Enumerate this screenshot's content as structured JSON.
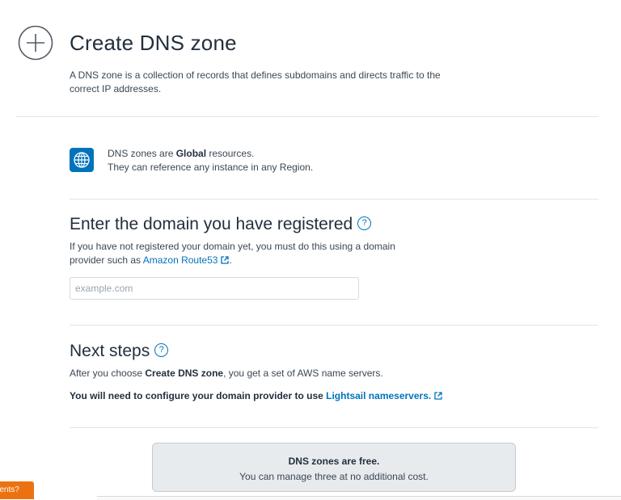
{
  "header": {
    "title": "Create DNS zone",
    "description": "A DNS zone is a collection of records that defines subdomains and directs traffic to the correct IP addresses.",
    "icon": "plus-circle-icon"
  },
  "info": {
    "icon": "globe-icon",
    "line1_prefix": "DNS zones are ",
    "line1_bold": "Global",
    "line1_suffix": " resources.",
    "line2": "They can reference any instance in any Region."
  },
  "domain_section": {
    "title": "Enter the domain you have registered",
    "help": "?",
    "text_line1": "If you have not registered your domain yet, you must do this using a domain",
    "text_line2_prefix": "provider such as ",
    "link_label": "Amazon Route53",
    "text_line2_suffix": ".",
    "input_placeholder": "example.com",
    "input_value": ""
  },
  "next_steps": {
    "title": "Next steps",
    "help": "?",
    "text_prefix": "After you choose ",
    "text_bold": "Create DNS zone",
    "text_suffix": ", you get a set of AWS name servers.",
    "bold_line_prefix": "You will need to configure your domain provider to use ",
    "link_label": "Lightsail nameservers."
  },
  "pricing": {
    "title": "DNS zones are free.",
    "subtitle": "You can manage three at no additional cost."
  },
  "feedback": {
    "label": "ments?"
  },
  "colors": {
    "link": "#0073bb",
    "accent_orange": "#ec7211",
    "badge": "#0073bb"
  }
}
